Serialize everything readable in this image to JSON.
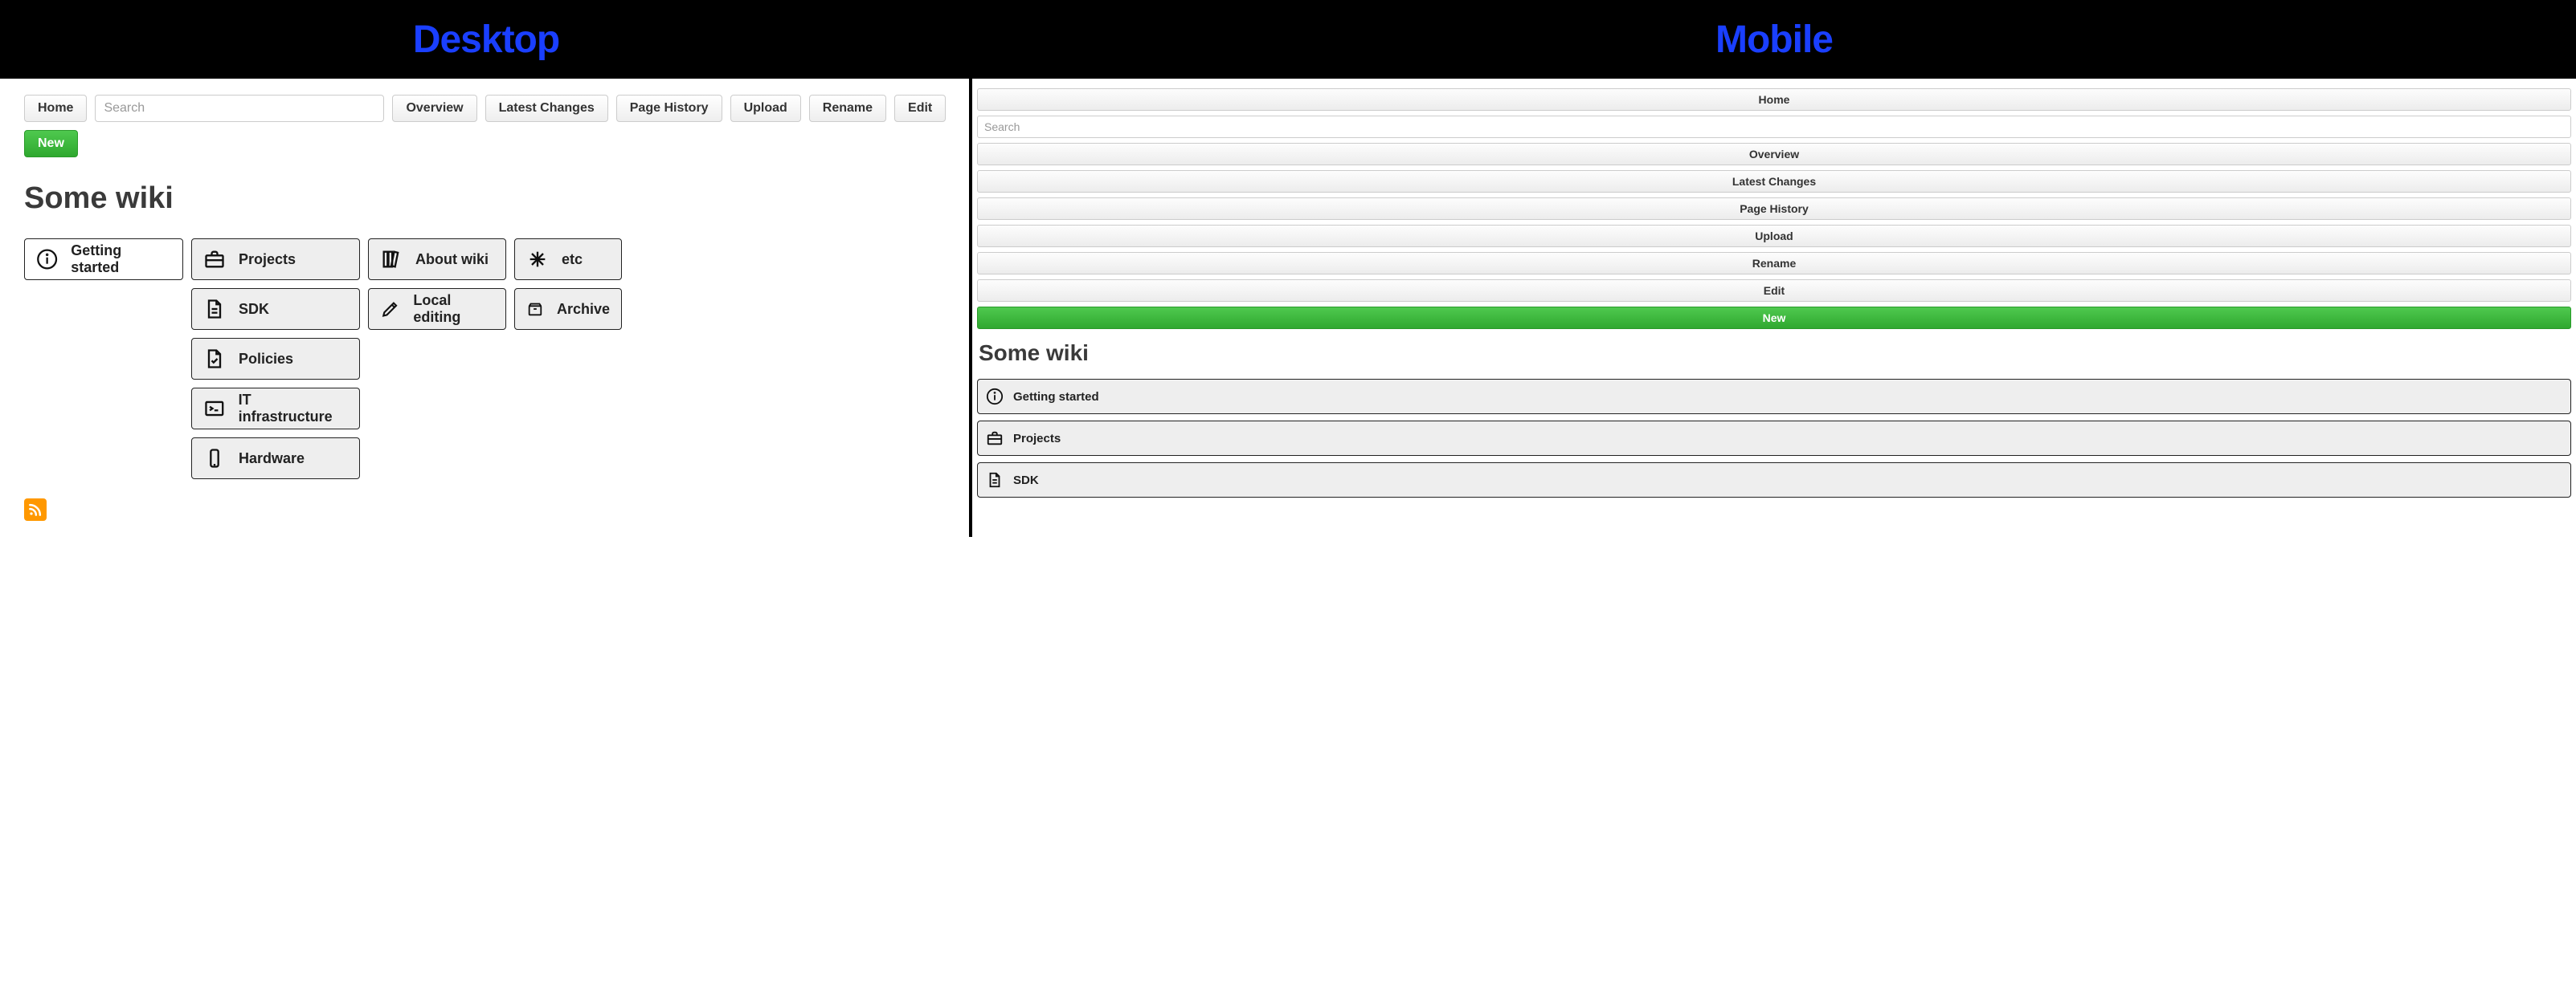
{
  "banner": {
    "desktop": "Desktop",
    "mobile": "Mobile"
  },
  "toolbar": {
    "home": "Home",
    "search_placeholder": "Search",
    "overview": "Overview",
    "latest": "Latest Changes",
    "history": "Page History",
    "upload": "Upload",
    "rename": "Rename",
    "edit": "Edit",
    "new": "New"
  },
  "title": "Some wiki",
  "cards": {
    "getting_started": "Getting started",
    "projects": "Projects",
    "sdk": "SDK",
    "policies": "Policies",
    "it": "IT infrastructure",
    "hardware": "Hardware",
    "about": "About wiki",
    "local": "Local editing",
    "etc": "etc",
    "archive": "Archive"
  }
}
